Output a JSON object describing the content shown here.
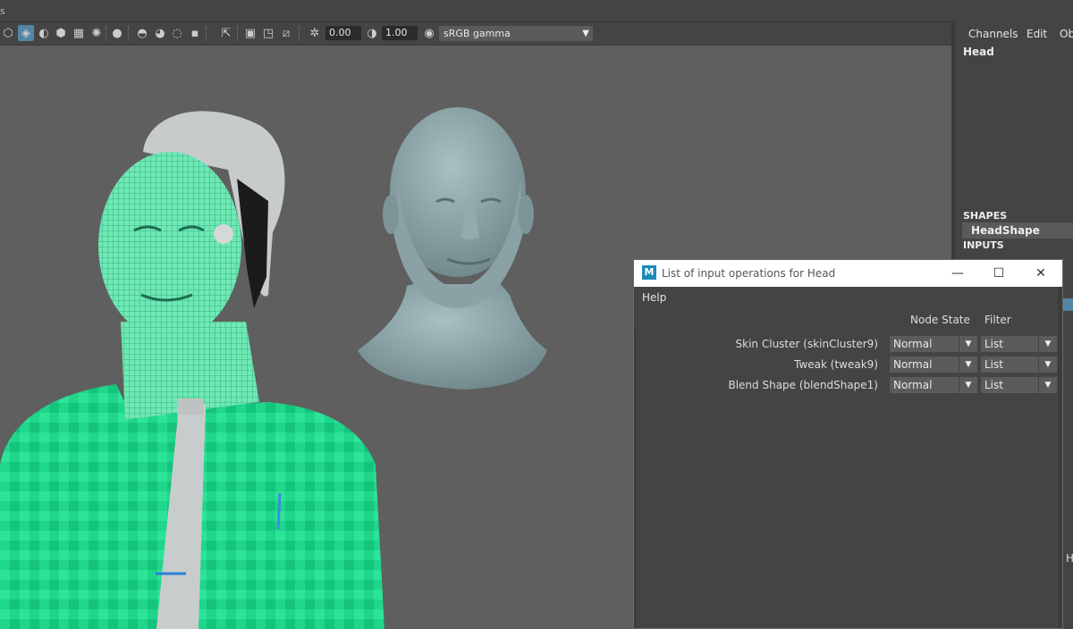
{
  "viewport": {
    "toolbar": {
      "exposure_value": "0.00",
      "gamma_value": "1.00",
      "color_space": "sRGB gamma",
      "icons": [
        "wireframe-cube-icon",
        "shaded-cube-icon",
        "textured-icon",
        "wireframe-on-shaded-icon",
        "checker-icon",
        "light-icon",
        "shadow-icon",
        "ao-icon",
        "motion-blur-icon",
        "aa-icon",
        "isolate-icon",
        "xray-icon",
        "grid-icon",
        "resolution-gate-icon",
        "film-gate-icon",
        "frame-icon",
        "exposure-icon",
        "gamma-icon",
        "color-management-icon"
      ]
    }
  },
  "channel_box": {
    "menu": [
      "Channels",
      "Edit",
      "Ob"
    ],
    "object_name": "Head",
    "shapes_header": "SHAPES",
    "shape_name": "HeadShape",
    "inputs_header": "INPUTS",
    "right_cut_letter": "H"
  },
  "dialog": {
    "title": "List of input operations for Head",
    "menu_help": "Help",
    "col_node_state": "Node State",
    "col_filter": "Filter",
    "operations": [
      {
        "label": "Skin Cluster (skinCluster9)",
        "state": "Normal",
        "filter": "List"
      },
      {
        "label": "Tweak (tweak9)",
        "state": "Normal",
        "filter": "List"
      },
      {
        "label": "Blend Shape (blendShape1)",
        "state": "Normal",
        "filter": "List"
      }
    ],
    "accent_color": "#1c8bb5"
  }
}
